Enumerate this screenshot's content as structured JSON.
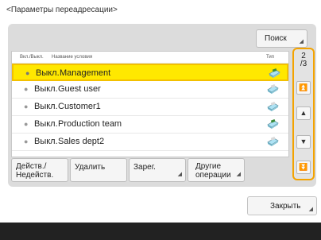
{
  "title": "<Параметры переадресации>",
  "search": {
    "label": "Поиск"
  },
  "list": {
    "headers": {
      "status": "Вкл./Выкл.",
      "name": "Название условия",
      "type": "Тип"
    },
    "rows": [
      {
        "status": "Выкл.",
        "name": "Management",
        "selected": true
      },
      {
        "status": "Выкл.",
        "name": "Guest user",
        "selected": false
      },
      {
        "status": "Выкл.",
        "name": "Customer1",
        "selected": false
      },
      {
        "status": "Выкл.",
        "name": "Production team",
        "selected": false
      },
      {
        "status": "Выкл.",
        "name": "Sales dept2",
        "selected": false
      }
    ]
  },
  "pager": {
    "current": "2",
    "total": "/3"
  },
  "scroll_icons": [
    "scroll-top-icon",
    "scroll-up-icon",
    "scroll-down-icon",
    "scroll-bottom-icon"
  ],
  "actions": {
    "toggle_line1": "Действ./",
    "toggle_line2": "Недейств.",
    "delete": "Удалить",
    "register": "Зарег.",
    "other_line1": "Другие",
    "other_line2": "операции"
  },
  "close": {
    "label": "Закрыть"
  },
  "colors": {
    "selected_row": "#ffe800",
    "scroll_frame": "#f4a300",
    "panel": "#dcdcdc",
    "footer": "#222222"
  }
}
